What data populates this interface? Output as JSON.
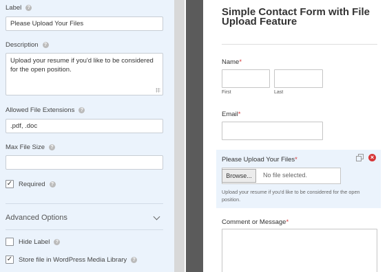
{
  "options_panel": {
    "label_field": {
      "label": "Label",
      "value": "Please Upload Your Files"
    },
    "description_field": {
      "label": "Description",
      "value": "Upload your resume if you'd like to be considered\nfor the open position."
    },
    "extensions_field": {
      "label": "Allowed File Extensions",
      "value": ".pdf, .doc"
    },
    "max_size_field": {
      "label": "Max File Size",
      "value": ""
    },
    "required": {
      "label": "Required",
      "checked": true,
      "mark": "✓"
    },
    "advanced_options": {
      "label": "Advanced Options"
    },
    "hide_label": {
      "label": "Hide Label",
      "checked": false
    },
    "media_library": {
      "label": "Store file in WordPress Media Library",
      "checked": true,
      "mark": "✓"
    },
    "help_icon": "?"
  },
  "preview": {
    "form_title": "Simple Contact Form with File Upload Feature",
    "name": {
      "label": "Name",
      "required_mark": "*",
      "first": "First",
      "last": "Last"
    },
    "email": {
      "label": "Email",
      "required_mark": "*"
    },
    "upload": {
      "label": "Please Upload Your Files",
      "required_mark": "*",
      "browse": "Browse...",
      "no_file": "No file selected.",
      "description": "Upload your resume if you'd like to be considered for the open position."
    },
    "comment": {
      "label": "Comment or Message",
      "required_mark": "*"
    },
    "delete_mark": "×"
  },
  "colors": {
    "panel_bg": "#ebf3fc",
    "required": "#d63638",
    "dark_bar": "#5b5b5b"
  }
}
